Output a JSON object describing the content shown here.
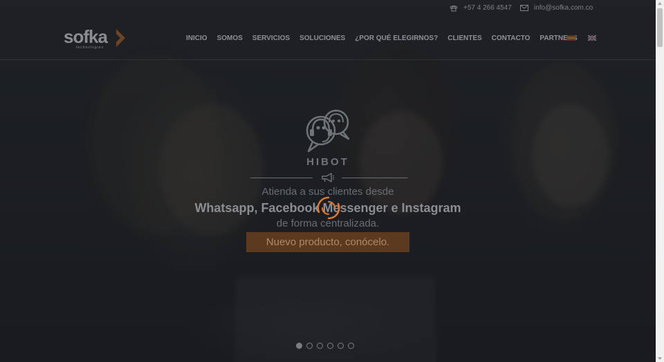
{
  "topbar": {
    "phone_icon": "phone-icon",
    "phone": "+57 4 266 4547",
    "mail_icon": "mail-icon",
    "email": "info@sofka.com.co"
  },
  "header": {
    "logo_text": "sofka",
    "logo_tagline": "technologies",
    "nav": [
      "INICIO",
      "SOMOS",
      "SERVICIOS",
      "SOLUCIONES",
      "¿POR QUÉ ELEGIRNOS?",
      "CLIENTES",
      "CONTACTO",
      "PARTNERS"
    ],
    "flags": [
      "spain-flag-icon",
      "uk-flag-icon"
    ]
  },
  "hero": {
    "product_name": "HIBOT",
    "line1": "Atienda a sus clientes desde",
    "line2": "Whatsapp, Facebook Messenger e Instagram",
    "line3": "de forma centralizada.",
    "cta_label": "Nuevo producto, conócelo."
  },
  "slider": {
    "count": 6,
    "active_index": 0
  },
  "colors": {
    "accent": "#e87722",
    "overlay": "#16181c"
  }
}
